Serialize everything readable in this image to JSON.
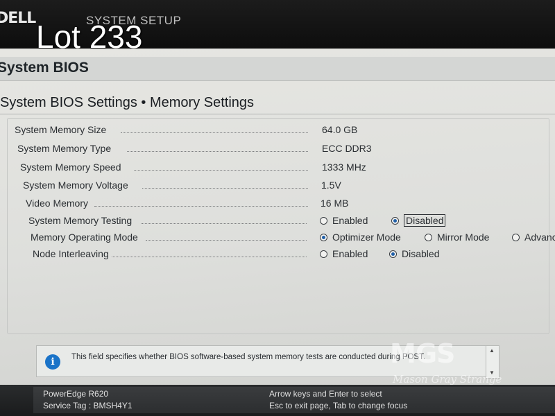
{
  "header": {
    "logo": "DELL",
    "title": "SYSTEM SETUP",
    "overlay_label": "Lot 233"
  },
  "page": {
    "title": "System BIOS",
    "section_title": "System BIOS Settings • Memory Settings"
  },
  "settings": {
    "rows": [
      {
        "label": "System Memory Size",
        "value": "64.0 GB"
      },
      {
        "label": "System Memory Type",
        "value": "ECC DDR3"
      },
      {
        "label": "System Memory Speed",
        "value": "1333 MHz"
      },
      {
        "label": "System Memory Voltage",
        "value": "1.5V"
      },
      {
        "label": "Video Memory",
        "value": "16 MB"
      }
    ],
    "memory_testing": {
      "label": "System Memory Testing",
      "options": [
        "Enabled",
        "Disabled"
      ],
      "selected": "Disabled"
    },
    "operating_mode": {
      "label": "Memory Operating Mode",
      "options": [
        "Optimizer Mode",
        "Mirror Mode",
        "Advanc"
      ],
      "selected": "Optimizer Mode"
    },
    "node_interleaving": {
      "label": "Node Interleaving",
      "options": [
        "Enabled",
        "Disabled"
      ],
      "selected": "Disabled"
    }
  },
  "help": {
    "text": "This field specifies whether BIOS software-based system memory tests are conducted during POST."
  },
  "watermark": {
    "logo": "MGS",
    "text": "Mason Gray Strange"
  },
  "footer": {
    "model": "PowerEdge R620",
    "service_tag": "Service Tag : BMSH4Y1",
    "hint_1": "Arrow keys and Enter to select",
    "hint_2": "Esc to exit page, Tab to change focus"
  },
  "colors": {
    "screen_bg": "#e2e3e0",
    "radio_selected": "#1f5fa8",
    "info_icon": "#1a73c8"
  },
  "icons": [
    "info-icon",
    "scroll-up-arrow-icon",
    "scroll-down-arrow-icon"
  ]
}
